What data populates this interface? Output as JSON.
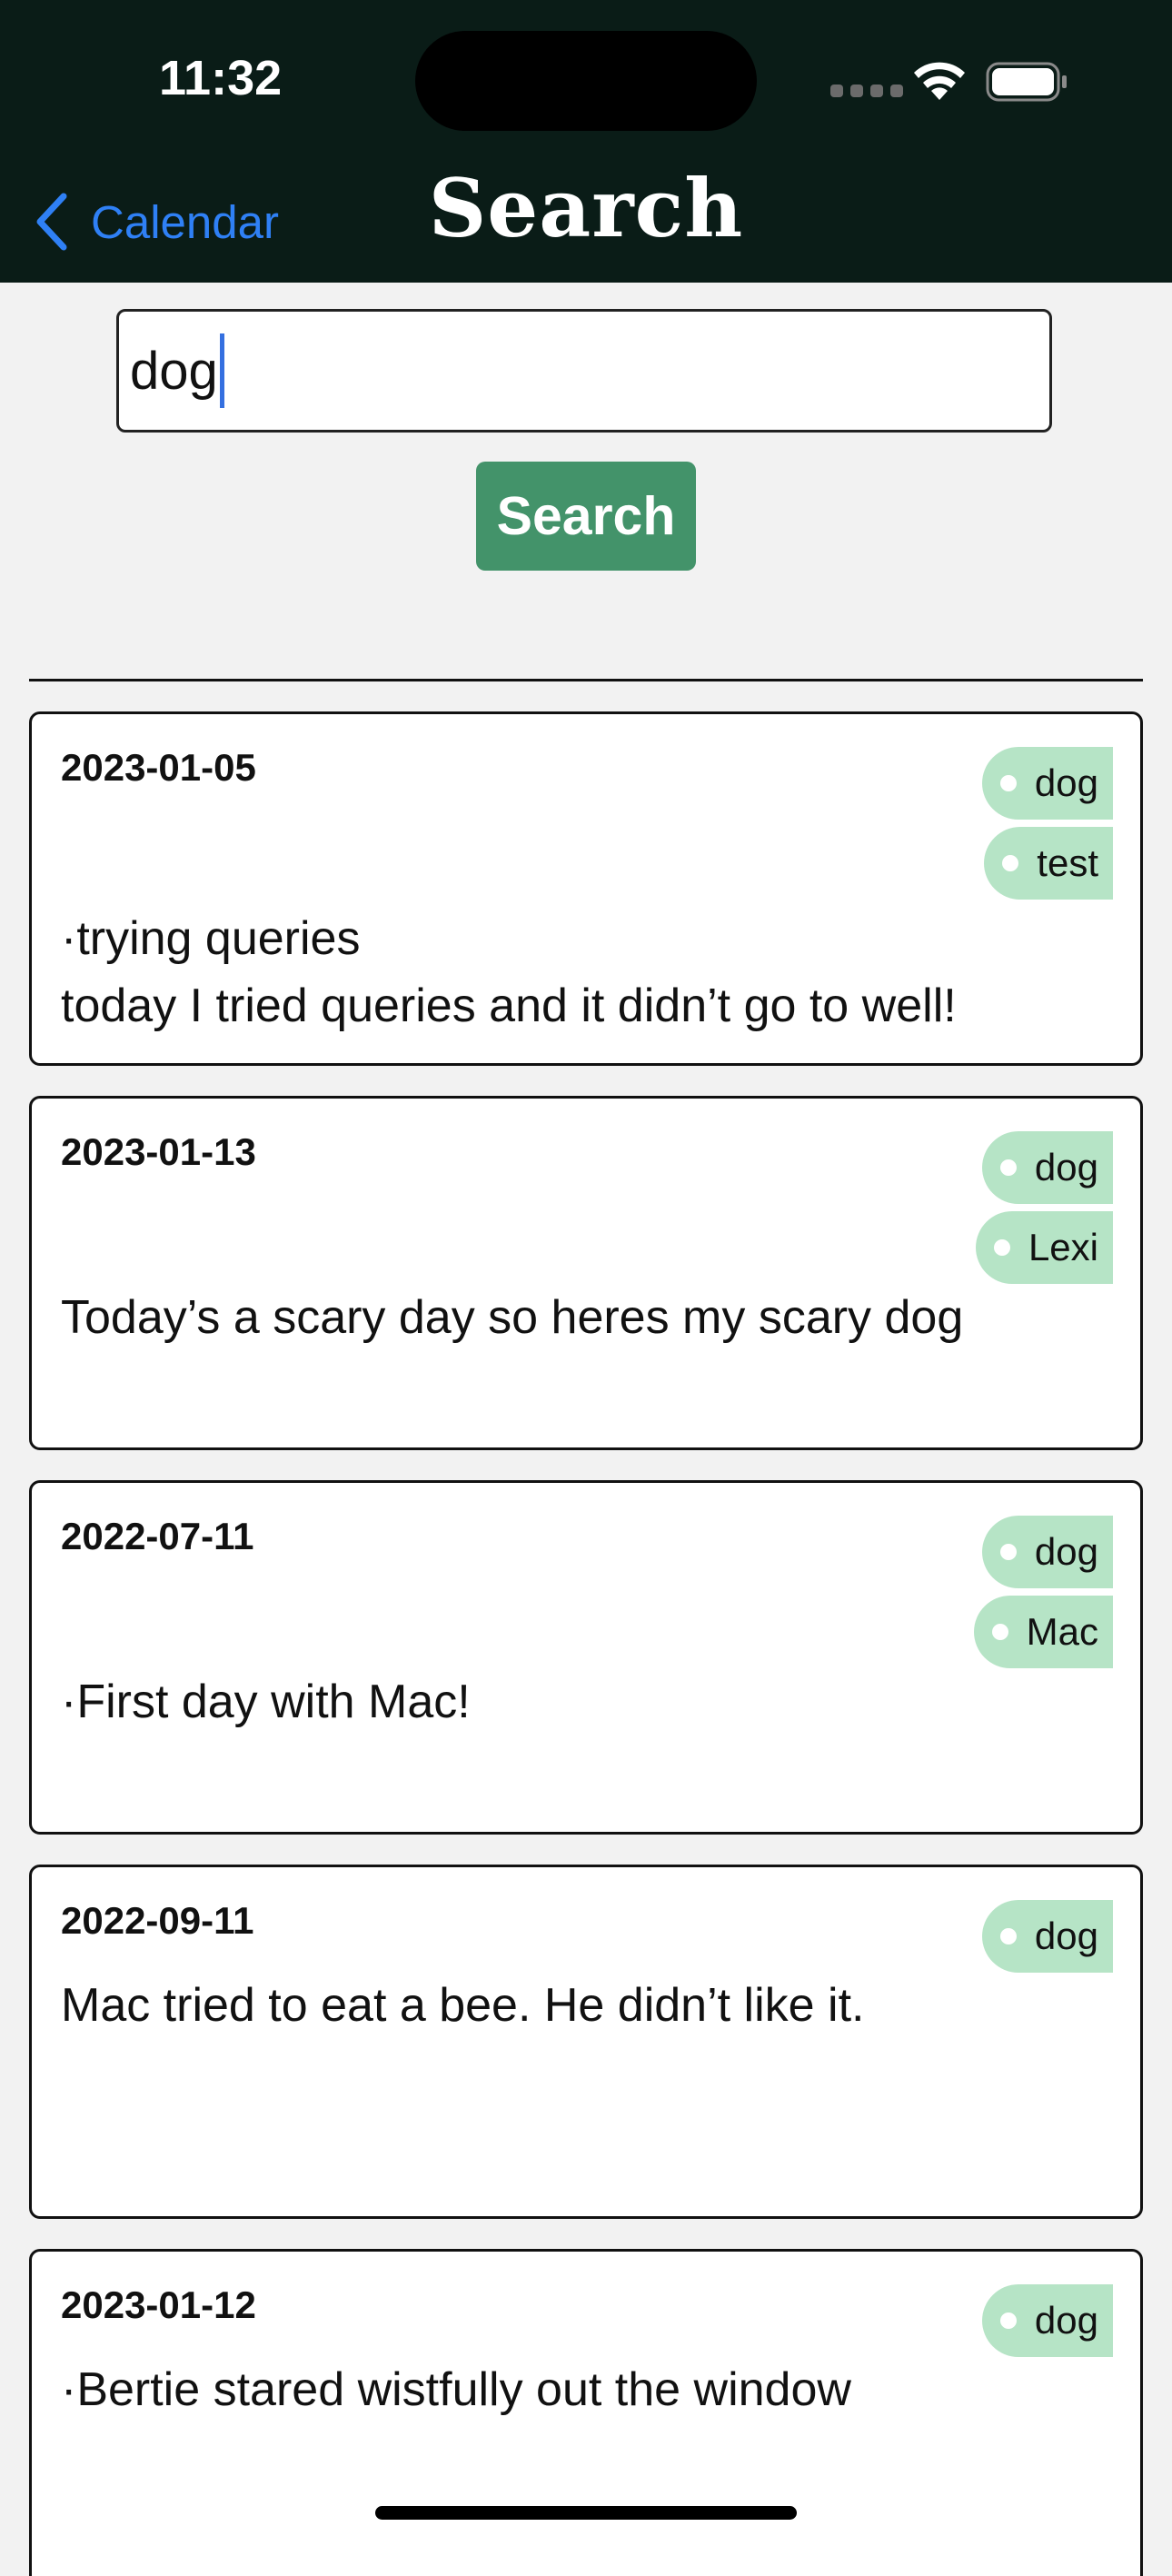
{
  "status_bar": {
    "time": "11:32"
  },
  "nav": {
    "back_label": "Calendar",
    "title": "Search"
  },
  "search": {
    "query": "dog",
    "button_label": "Search"
  },
  "results": [
    {
      "date": "2023-01-05",
      "tags": [
        "dog",
        "test"
      ],
      "lines": [
        "·trying queries",
        "today I tried queries and it didn’t go to well!"
      ]
    },
    {
      "date": "2023-01-13",
      "tags": [
        "dog",
        "Lexi"
      ],
      "lines": [
        "Today’s a scary day so heres my scary dog"
      ]
    },
    {
      "date": "2022-07-11",
      "tags": [
        "dog",
        "Mac"
      ],
      "lines": [
        "·First day with Mac!"
      ]
    },
    {
      "date": "2022-09-11",
      "tags": [
        "dog"
      ],
      "lines": [
        "Mac tried to eat a bee. He didn’t like it."
      ]
    },
    {
      "date": "2023-01-12",
      "tags": [
        "dog"
      ],
      "lines": [
        "·Bertie stared wistfully out the window"
      ]
    }
  ]
}
